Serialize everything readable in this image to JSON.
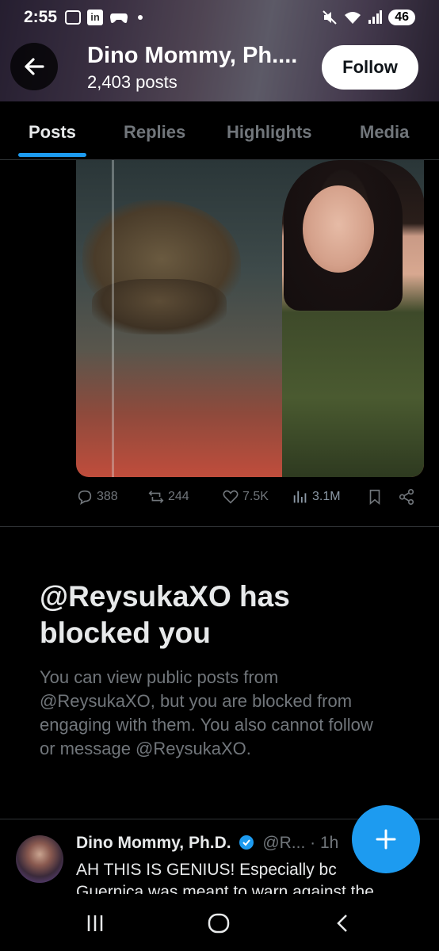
{
  "status_bar": {
    "time": "2:55",
    "battery": "46",
    "left_icons": [
      "screenshot-icon",
      "linkedin-icon",
      "gamepad-icon",
      "dot-icon"
    ],
    "right_icons": [
      "mute-icon",
      "wifi-icon",
      "signal-icon",
      "battery-icon"
    ]
  },
  "header": {
    "profile_name": "Dino Mommy, Ph....",
    "post_count": "2,403 posts",
    "follow_label": "Follow"
  },
  "tabs": [
    {
      "label": "Posts",
      "active": true
    },
    {
      "label": "Replies",
      "active": false
    },
    {
      "label": "Highlights",
      "active": false
    },
    {
      "label": "Media",
      "active": false
    }
  ],
  "post1": {
    "replies": "388",
    "reposts": "244",
    "likes": "7.5K",
    "views": "3.1M"
  },
  "blocked": {
    "title": "@ReysukaXO has blocked you",
    "body": "You can view public posts from @ReysukaXO, but you are blocked from engaging with them. You also cannot follow or message @ReysukaXO."
  },
  "post2": {
    "name": "Dino Mommy, Ph.D.",
    "handle": "@R...",
    "time": "· 1h",
    "text_line1": "AH THIS IS GENIUS! Especially bc",
    "text_line2": "Guernica was meant to warn against the"
  },
  "colors": {
    "accent": "#1d9bf0",
    "muted": "#71767b",
    "text": "#e7e9ea"
  }
}
